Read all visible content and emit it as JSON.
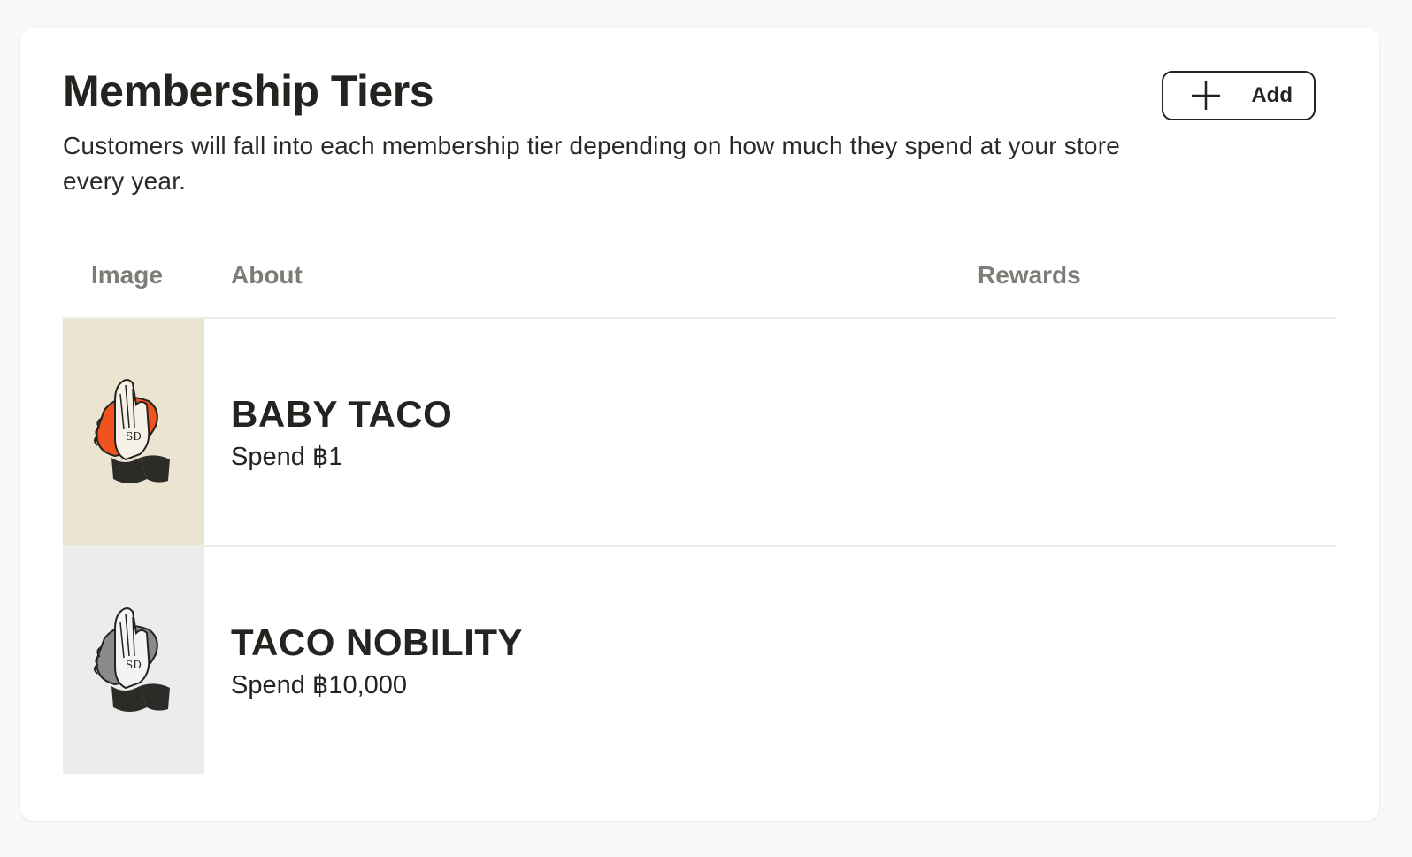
{
  "header": {
    "title": "Membership Tiers",
    "description": "Customers will fall into each membership tier depending on how much they spend at your store every year.",
    "add_label": "Add"
  },
  "table": {
    "columns": [
      "Image",
      "About",
      "Rewards"
    ],
    "rows": [
      {
        "name": "BABY TACO",
        "spend": "Spend ฿1",
        "image_icon": "praying-hands-taco-icon",
        "bg_color": "#ebe4d1",
        "accent_color": "#f0531d"
      },
      {
        "name": "TACO NOBILITY",
        "spend": "Spend ฿10,000",
        "image_icon": "praying-hands-taco-icon",
        "bg_color": "#ececec",
        "accent_color": "#8a8a8a"
      }
    ]
  },
  "colors": {
    "text": "#23231f",
    "muted": "#7d7d78",
    "page_bg": "#f8f9fa",
    "card_bg": "#ffffff"
  }
}
